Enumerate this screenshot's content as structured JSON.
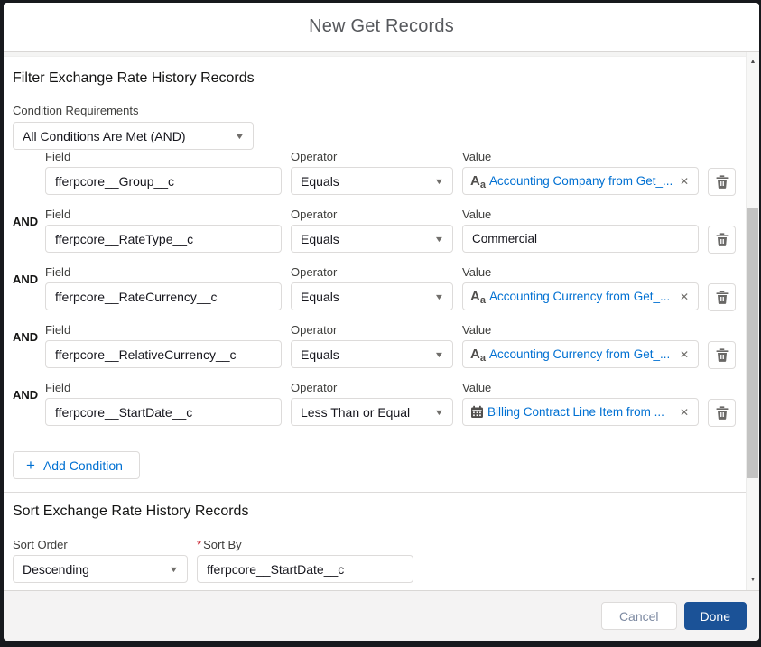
{
  "modal": {
    "title": "New Get Records"
  },
  "filter_section": {
    "title": "Filter Exchange Rate History Records",
    "condition_requirements_label": "Condition Requirements",
    "condition_requirements_value": "All Conditions Are Met (AND)",
    "column_labels": {
      "field": "Field",
      "operator": "Operator",
      "value": "Value"
    },
    "conditions": [
      {
        "and_label": "",
        "field": "fferpcore__Group__c",
        "operator": "Equals",
        "value": {
          "kind": "resource",
          "icon": "text-type-icon",
          "text": "Accounting Company from Get_..."
        }
      },
      {
        "and_label": "AND",
        "field": "fferpcore__RateType__c",
        "operator": "Equals",
        "value": {
          "kind": "text",
          "icon": "",
          "text": "Commercial"
        }
      },
      {
        "and_label": "AND",
        "field": "fferpcore__RateCurrency__c",
        "operator": "Equals",
        "value": {
          "kind": "resource",
          "icon": "text-type-icon",
          "text": "Accounting Currency from Get_..."
        }
      },
      {
        "and_label": "AND",
        "field": "fferpcore__RelativeCurrency__c",
        "operator": "Equals",
        "value": {
          "kind": "resource",
          "icon": "text-type-icon",
          "text": "Accounting Currency from Get_..."
        }
      },
      {
        "and_label": "AND",
        "field": "fferpcore__StartDate__c",
        "operator": "Less Than or Equal",
        "value": {
          "kind": "resource",
          "icon": "calendar-icon",
          "text": "Billing Contract Line Item from ..."
        }
      }
    ],
    "add_condition_label": "Add Condition"
  },
  "sort_section": {
    "title": "Sort Exchange Rate History Records",
    "sort_order_label": "Sort Order",
    "sort_by_label": "Sort By",
    "sort_by_required": "*",
    "sort_order_value": "Descending",
    "sort_by_value": "fferpcore__StartDate__c"
  },
  "footer": {
    "cancel_label": "Cancel",
    "done_label": "Done"
  },
  "colors": {
    "accent_blue": "#0070d2",
    "done_button_blue": "#1b5297",
    "required_red": "#cb2a37",
    "input_border": "#dddbda",
    "icon_gray": "#706e6b"
  }
}
